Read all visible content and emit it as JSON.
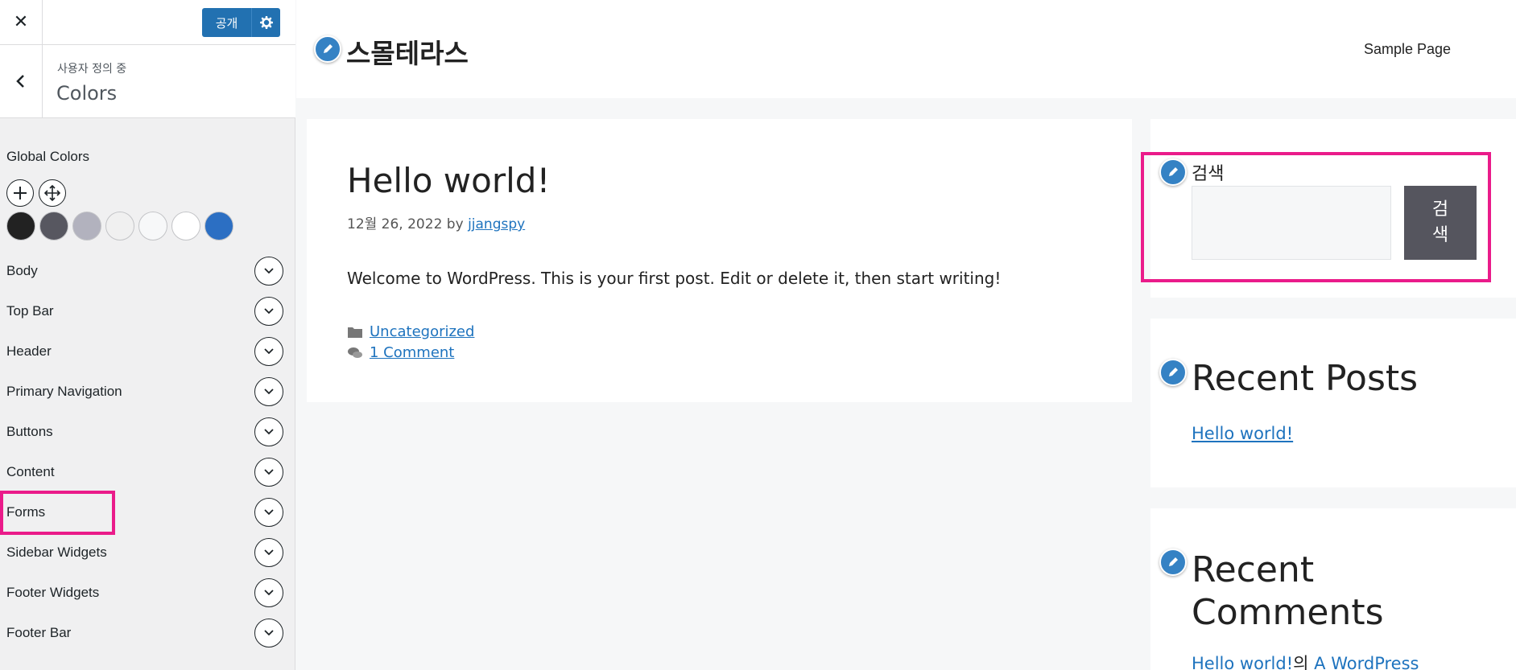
{
  "customizer": {
    "close_label": "✕",
    "publish_label": "공개",
    "breadcrumb": "사용자 정의 중",
    "section_title": "Colors",
    "global_colors_label": "Global Colors",
    "swatches": [
      "#222222",
      "#575760",
      "#b2b2be",
      "#f0f0f0",
      "#f7f8f9",
      "#ffffff",
      "#2c6fc3"
    ],
    "rows": [
      {
        "label": "Body"
      },
      {
        "label": "Top Bar"
      },
      {
        "label": "Header"
      },
      {
        "label": "Primary Navigation"
      },
      {
        "label": "Buttons"
      },
      {
        "label": "Content"
      },
      {
        "label": "Forms"
      },
      {
        "label": "Sidebar Widgets"
      },
      {
        "label": "Footer Widgets"
      },
      {
        "label": "Footer Bar"
      }
    ],
    "highlight_color": "#ea1b8a"
  },
  "preview": {
    "site_title": "스몰테라스",
    "nav_item": "Sample Page",
    "post": {
      "title": "Hello world!",
      "date": "12월 26, 2022",
      "by": "by",
      "author": "jjangspy",
      "body": "Welcome to WordPress. This is your first post. Edit or delete it, then start writing!",
      "category": "Uncategorized",
      "comments": "1 Comment"
    },
    "search_widget": {
      "title": "검색",
      "button_label": "검\n색"
    },
    "recent_posts": {
      "title": "Recent Posts",
      "items": [
        "Hello world!"
      ]
    },
    "recent_comments": {
      "title": "Recent\nComments",
      "post_link": "Hello world!",
      "connector": "의",
      "author_link": "A WordPress"
    },
    "accent_color": "#1e73be"
  }
}
